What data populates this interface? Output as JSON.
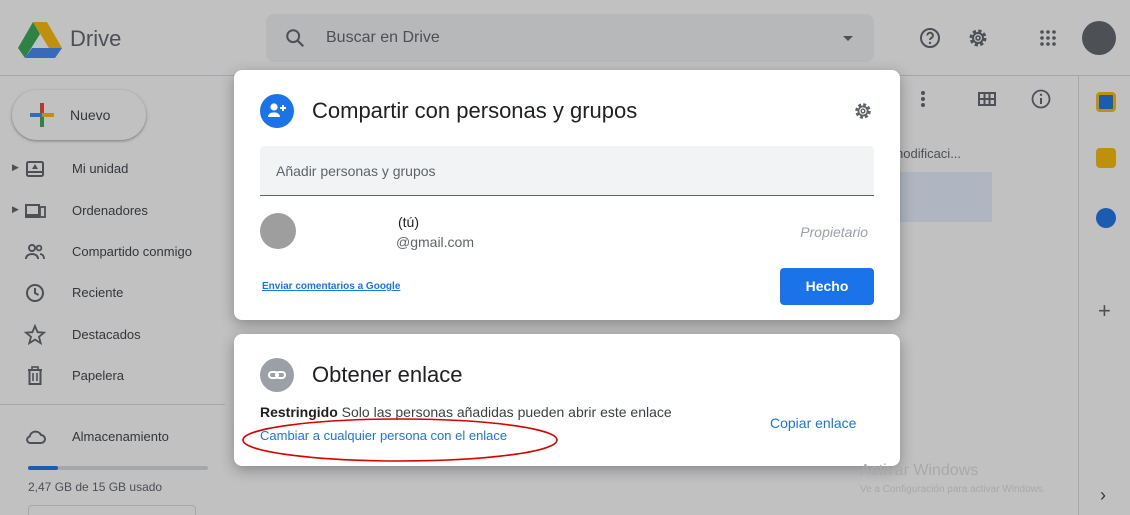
{
  "header": {
    "app_name": "Drive",
    "search_placeholder": "Buscar en Drive"
  },
  "sidebar": {
    "new_label": "Nuevo",
    "items": [
      {
        "label": "Mi unidad",
        "icon": "drive-icon"
      },
      {
        "label": "Ordenadores",
        "icon": "computer-icon"
      },
      {
        "label": "Compartido conmigo",
        "icon": "people-icon"
      },
      {
        "label": "Reciente",
        "icon": "clock-icon"
      },
      {
        "label": "Destacados",
        "icon": "star-icon"
      },
      {
        "label": "Papelera",
        "icon": "trash-icon"
      },
      {
        "label": "Almacenamiento",
        "icon": "cloud-icon"
      }
    ],
    "storage_text": "2,47 GB de 15 GB usado",
    "storage_fraction": 0.165
  },
  "main": {
    "column_header": "nodificaci..."
  },
  "share_dialog": {
    "title": "Compartir con personas y grupos",
    "add_placeholder": "Añadir personas y grupos",
    "person_you": "(tú)",
    "person_email": "@gmail.com",
    "person_role": "Propietario",
    "feedback_link": "Enviar comentarios a Google",
    "done_label": "Hecho"
  },
  "link_dialog": {
    "title": "Obtener enlace",
    "restricted_label": "Restringido",
    "restricted_desc": "Solo las personas añadidas pueden abrir este enlace",
    "change_link": "Cambiar a cualquier persona con el enlace",
    "copy_link": "Copiar enlace"
  },
  "watermark": {
    "line1": "Activar Windows",
    "line2": "Ve a Configuración para activar Windows."
  },
  "colors": {
    "accent": "#1a73e8",
    "annotation": "#d50000"
  }
}
